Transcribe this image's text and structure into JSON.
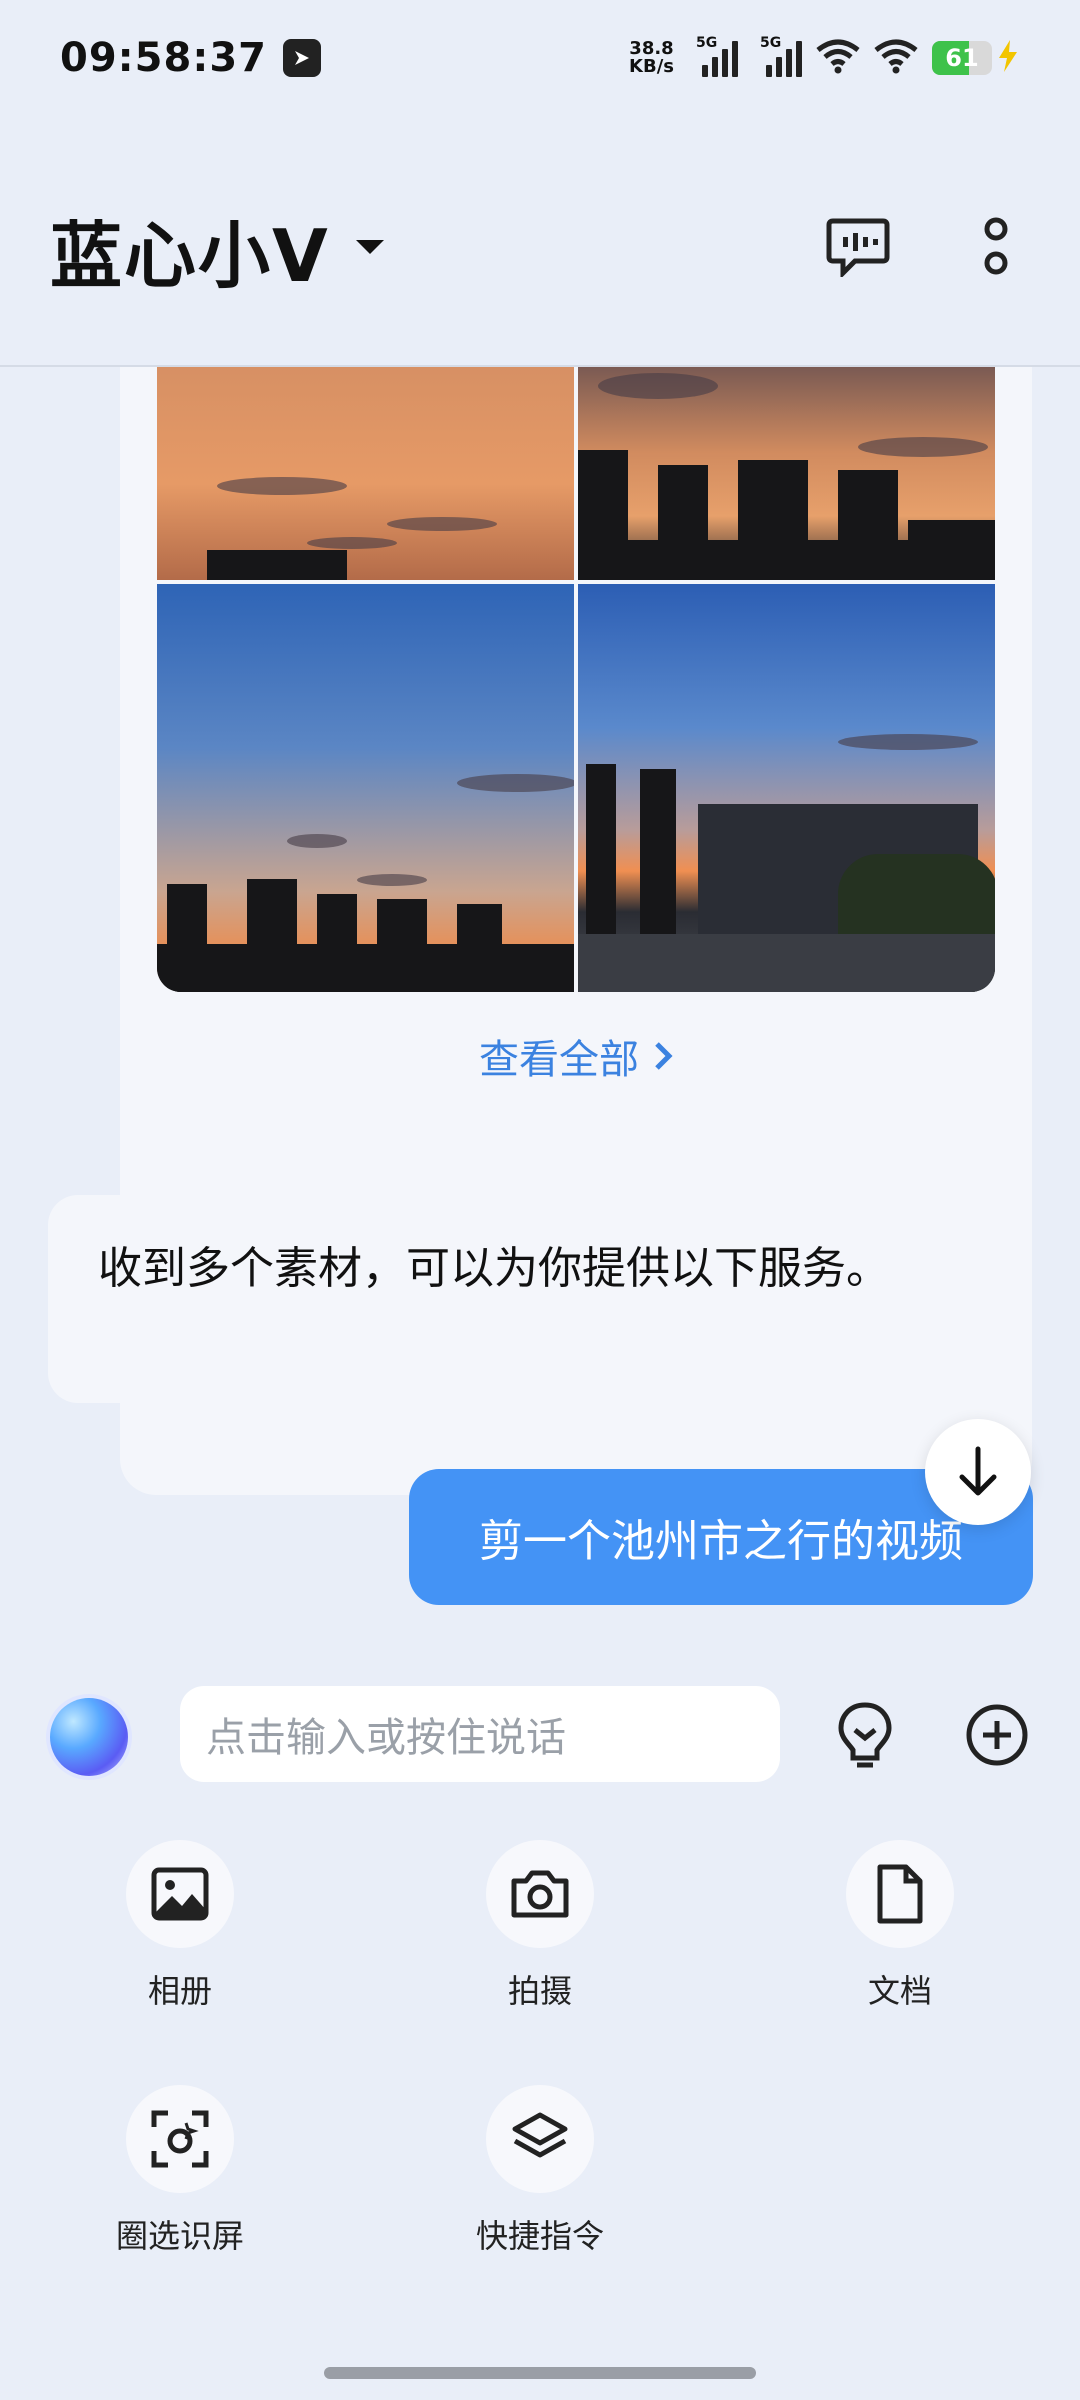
{
  "status_bar": {
    "time": "09:58:37",
    "net_speed_value": "38.8",
    "net_speed_unit": "KB/s",
    "sig1_label": "5G",
    "sig2_label": "5G",
    "battery": "61"
  },
  "header": {
    "title": "蓝心小V"
  },
  "chat": {
    "view_all": "查看全部",
    "bot_message": "收到多个素材，可以为你提供以下服务。",
    "user_message": "剪一个池州市之行的视频"
  },
  "input": {
    "placeholder": "点击输入或按住说话"
  },
  "tools": [
    {
      "label": "相册",
      "icon": "image-icon"
    },
    {
      "label": "拍摄",
      "icon": "camera-icon"
    },
    {
      "label": "文档",
      "icon": "document-icon"
    },
    {
      "label": "圈选识屏",
      "icon": "screen-select-icon"
    },
    {
      "label": "快捷指令",
      "icon": "layers-icon"
    }
  ],
  "colors": {
    "accent": "#4493f5",
    "link": "#3b82e0",
    "background": "#e9eef8"
  }
}
